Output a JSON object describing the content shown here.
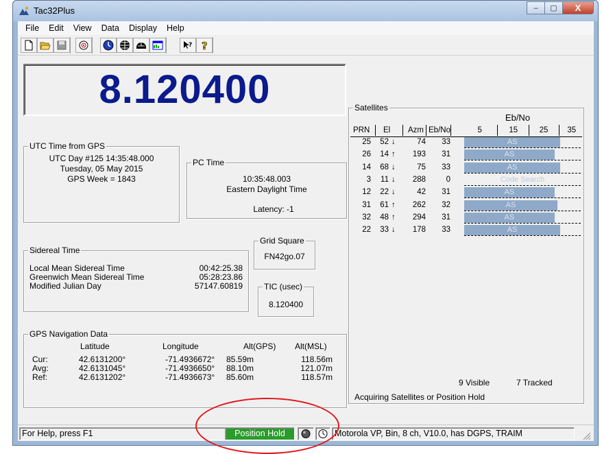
{
  "window": {
    "title": "Tac32Plus",
    "minimize": "–",
    "maximize": "▢",
    "close": "X"
  },
  "menu": [
    "File",
    "Edit",
    "View",
    "Data",
    "Display",
    "Help"
  ],
  "frequency": "8.120400",
  "utc": {
    "label": "UTC Time from GPS",
    "day_time": "UTC Day #125  14:35:48.000",
    "date": "Tuesday, 05 May 2015",
    "week": "GPS Week = 1843"
  },
  "pc_time": {
    "label": "PC Time",
    "time": "10:35:48.003",
    "zone": "Eastern Daylight Time",
    "latency": "Latency:  -1"
  },
  "sidereal": {
    "label": "Sidereal Time",
    "rows": [
      {
        "name": "Local Mean Sidereal Time",
        "value": "00:42:25.38"
      },
      {
        "name": "Greenwich Mean Sidereal Time",
        "value": "05:28:23.86"
      },
      {
        "name": "Modified Julian Day",
        "value": "57147.60819"
      }
    ]
  },
  "grid_square": {
    "label": "Grid Square",
    "value": "FN42go.07"
  },
  "tic": {
    "label": "TIC (usec)",
    "value": "8.120400"
  },
  "gps_nav": {
    "label": "GPS Navigation Data",
    "headers": [
      "Latitude",
      "Longitude",
      "Alt(GPS)",
      "Alt(MSL)"
    ],
    "rows": [
      {
        "name": "Cur:",
        "lat": "42.6131200°",
        "lon": "-71.4936672°",
        "alt_gps": "85.59m",
        "alt_msl": "118.56m"
      },
      {
        "name": "Avg:",
        "lat": "42.6131045°",
        "lon": "-71.4936650°",
        "alt_gps": "88.10m",
        "alt_msl": "121.07m"
      },
      {
        "name": "Ref:",
        "lat": "42.6131202°",
        "lon": "-71.4936673°",
        "alt_gps": "85.60m",
        "alt_msl": "118.57m"
      }
    ]
  },
  "satellites": {
    "label": "Satellites",
    "ebno_title": "Eb/No",
    "headers": {
      "prn": "PRN",
      "el": "El",
      "azm": "Azm",
      "ebno": "Eb/No"
    },
    "scale": [
      "5",
      "15",
      "25",
      "35"
    ],
    "rows": [
      {
        "prn": "25",
        "el": "52",
        "dir": "↓",
        "azm": "74",
        "ebno": "33",
        "status": "AS",
        "level": 33
      },
      {
        "prn": "26",
        "el": "14",
        "dir": "↑",
        "azm": "193",
        "ebno": "31",
        "status": "AS",
        "level": 31
      },
      {
        "prn": "14",
        "el": "68",
        "dir": "↓",
        "azm": "75",
        "ebno": "33",
        "status": "AS",
        "level": 33
      },
      {
        "prn": "3",
        "el": "11",
        "dir": "↓",
        "azm": "288",
        "ebno": "0",
        "status": "Code Search",
        "level": 0
      },
      {
        "prn": "12",
        "el": "22",
        "dir": "↓",
        "azm": "42",
        "ebno": "31",
        "status": "AS",
        "level": 31
      },
      {
        "prn": "31",
        "el": "61",
        "dir": "↑",
        "azm": "262",
        "ebno": "32",
        "status": "AS",
        "level": 32
      },
      {
        "prn": "32",
        "el": "48",
        "dir": "↑",
        "azm": "294",
        "ebno": "31",
        "status": "AS",
        "level": 31
      },
      {
        "prn": "22",
        "el": "33",
        "dir": "↓",
        "azm": "178",
        "ebno": "33",
        "status": "AS",
        "level": 33
      }
    ],
    "visible": "9 Visible",
    "tracked": "7 Tracked",
    "message": "Acquiring Satellites or Position Hold"
  },
  "status": {
    "help": "For Help, press F1",
    "hold": "Position Hold",
    "receiver": "Motorola VP, Bin, 8 ch, V10.0, has DGPS, TRAIM"
  },
  "colors": {
    "frequency": "#0b1a8c",
    "bar": "#8fa9c9",
    "hold": "#2a9c2a",
    "annotation": "#e0181c"
  }
}
